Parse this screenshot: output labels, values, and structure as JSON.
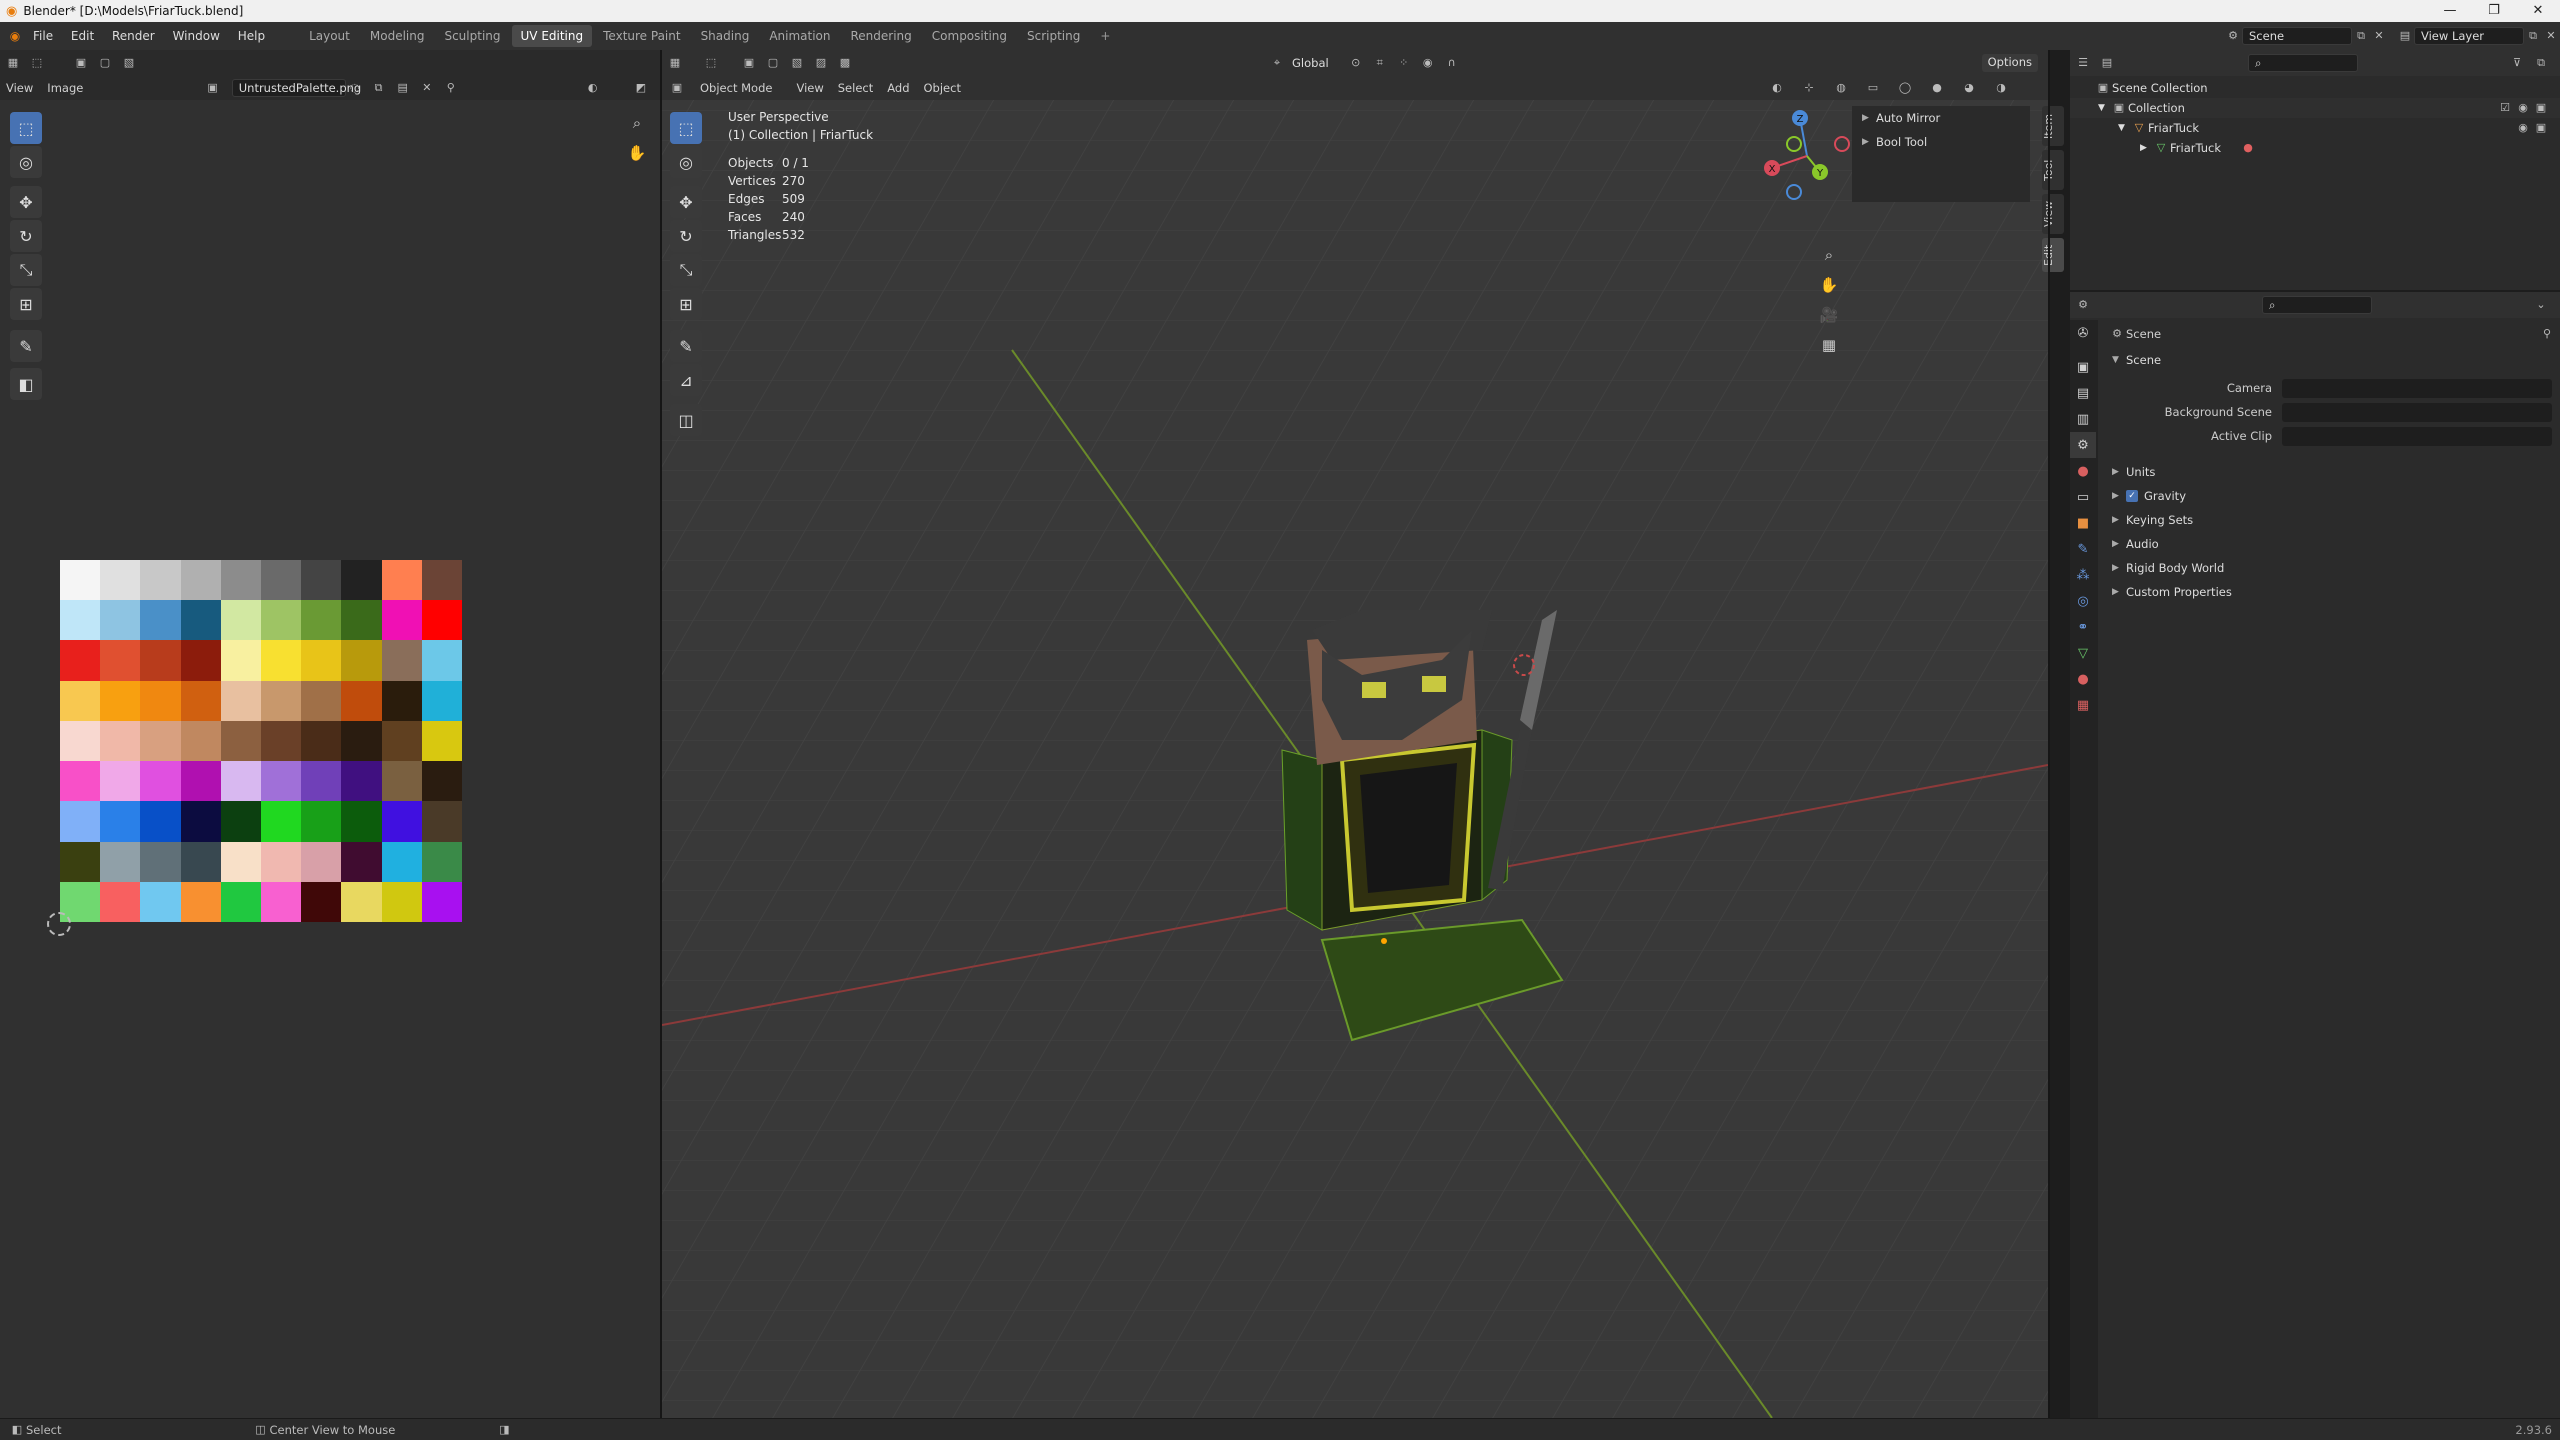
{
  "window": {
    "title": "Blender* [D:\\Models\\FriarTuck.blend]",
    "controls": [
      "—",
      "❐",
      "✕"
    ]
  },
  "menu": [
    "File",
    "Edit",
    "Render",
    "Window",
    "Help"
  ],
  "workspaces": [
    "Layout",
    "Modeling",
    "Sculpting",
    "UV Editing",
    "Texture Paint",
    "Shading",
    "Animation",
    "Rendering",
    "Compositing",
    "Scripting",
    "+"
  ],
  "active_workspace": "UV Editing",
  "scene_field": "Scene",
  "view_layer_field": "View Layer",
  "uv_editor": {
    "menu": [
      "View",
      "Image"
    ],
    "image_name": "UntrustedPalette.png",
    "palette": [
      [
        "#f5f5f5",
        "#e0e0e0",
        "#c8c8c8",
        "#b0b0b0",
        "#8c8c8c",
        "#6a6a6a",
        "#444444",
        "#222222",
        "#ff7f50",
        "#6b4436"
      ],
      [
        "#bfe6f8",
        "#8ec4e2",
        "#4a90c8",
        "#175a7e",
        "#d2e8a2",
        "#9ec464",
        "#6a9a34",
        "#3a6a1a",
        "#f010b4",
        "#ff0000"
      ],
      [
        "#e8201c",
        "#e05030",
        "#b83c1c",
        "#8c1c0c",
        "#f8f0a0",
        "#f8e030",
        "#e8c418",
        "#b89a0c",
        "#8a6e5a",
        "#6cc8e8"
      ],
      [
        "#f8c850",
        "#f8a010",
        "#f08810",
        "#d06010",
        "#e8c0a0",
        "#c8986c",
        "#a07048",
        "#c04c0c",
        "#2a1c0c",
        "#20b0d8"
      ],
      [
        "#f8d8d0",
        "#f0b8a8",
        "#d8a080",
        "#c08860",
        "#8c6040",
        "#6a4028",
        "#4a2c18",
        "#2a1c10",
        "#604020",
        "#d8c810"
      ],
      [
        "#f850c8",
        "#f0a8e8",
        "#e050e0",
        "#b010b0",
        "#d8b8f0",
        "#a070d8",
        "#7040b8",
        "#401080",
        "#7a6040",
        "#2a1c10"
      ],
      [
        "#80b0f8",
        "#2a80e8",
        "#0850c8",
        "#0c0c40",
        "#0c4010",
        "#20d820",
        "#18a018",
        "#0c5c0c",
        "#4010e0",
        "#4a3a28"
      ],
      [
        "#3a4010",
        "#90a0a8",
        "#607078",
        "#384850",
        "#f8e0c8",
        "#f0b8b0",
        "#d8a0a8",
        "#400c30",
        "#20b0e0",
        "#3a8a48"
      ],
      [
        "#70d870",
        "#f86060",
        "#70c8f0",
        "#f89030",
        "#20c840",
        "#f860d0",
        "#400808",
        "#e8d860",
        "#d0c810",
        "#a810f0"
      ]
    ]
  },
  "viewport": {
    "mode": "Object Mode",
    "menu": [
      "View",
      "Select",
      "Add",
      "Object"
    ],
    "orientation": "Global",
    "options": "Options",
    "perspective": "User Perspective",
    "collection_path": "(1) Collection | FriarTuck",
    "stats": [
      {
        "label": "Objects",
        "value": "0 / 1"
      },
      {
        "label": "Vertices",
        "value": "270"
      },
      {
        "label": "Edges",
        "value": "509"
      },
      {
        "label": "Faces",
        "value": "240"
      },
      {
        "label": "Triangles",
        "value": "532"
      }
    ],
    "npanel_items": [
      "Auto Mirror",
      "Bool Tool"
    ],
    "side_tabs": [
      "Item",
      "Tool",
      "View",
      "Edit"
    ],
    "axis_labels": {
      "x": "X",
      "y": "Y",
      "z": "Z"
    }
  },
  "outliner": {
    "rows": [
      {
        "label": "Scene Collection",
        "indent": 0
      },
      {
        "label": "Collection",
        "indent": 1
      },
      {
        "label": "FriarTuck",
        "indent": 2
      },
      {
        "label": "FriarTuck",
        "indent": 3
      }
    ]
  },
  "properties": {
    "context": "Scene",
    "panel_title": "Scene",
    "fields": [
      {
        "label": "Camera"
      },
      {
        "label": "Background Scene"
      },
      {
        "label": "Active Clip"
      }
    ],
    "sections": [
      "Units",
      "Gravity",
      "Keying Sets",
      "Audio",
      "Rigid Body World",
      "Custom Properties"
    ]
  },
  "statusbar": {
    "left": "Select",
    "middle": "Center View to Mouse",
    "version": "2.93.6"
  }
}
